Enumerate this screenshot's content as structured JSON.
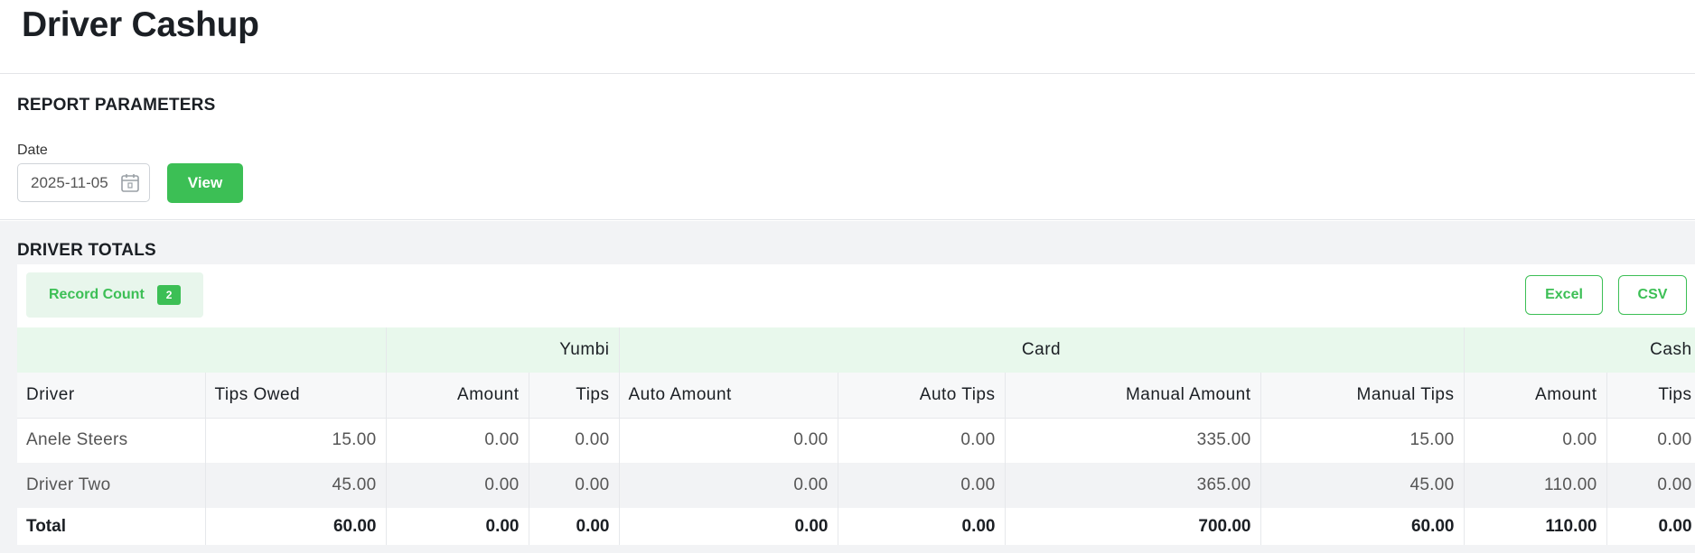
{
  "page": {
    "title": "Driver Cashup"
  },
  "params": {
    "section_title": "REPORT PARAMETERS",
    "date_label": "Date",
    "date_value": "2025-11-05",
    "view_label": "View"
  },
  "totals": {
    "section_title": "DRIVER TOTALS",
    "record_count_label": "Record Count",
    "record_count": "2",
    "excel_label": "Excel",
    "csv_label": "CSV"
  },
  "table": {
    "groups": {
      "yumbi": "Yumbi",
      "card": "Card",
      "cash": "Cash"
    },
    "columns": [
      "Driver",
      "Tips Owed",
      "Amount",
      "Tips",
      "Auto Amount",
      "Auto Tips",
      "Manual Amount",
      "Manual Tips",
      "Amount",
      "Tips"
    ],
    "rows": [
      [
        "Anele Steers",
        "15.00",
        "0.00",
        "0.00",
        "0.00",
        "0.00",
        "335.00",
        "15.00",
        "0.00",
        "0.00"
      ],
      [
        "Driver Two",
        "45.00",
        "0.00",
        "0.00",
        "0.00",
        "0.00",
        "365.00",
        "45.00",
        "110.00",
        "0.00"
      ]
    ],
    "total": [
      "Total",
      "60.00",
      "0.00",
      "0.00",
      "0.00",
      "0.00",
      "700.00",
      "60.00",
      "110.00",
      "0.00"
    ]
  },
  "colors": {
    "accent": "#3cbf55",
    "group_header_bg": "#e8f8ec",
    "record_count_bg": "#e8f6ec"
  },
  "icons": {
    "date_picker": "calendar-icon"
  }
}
